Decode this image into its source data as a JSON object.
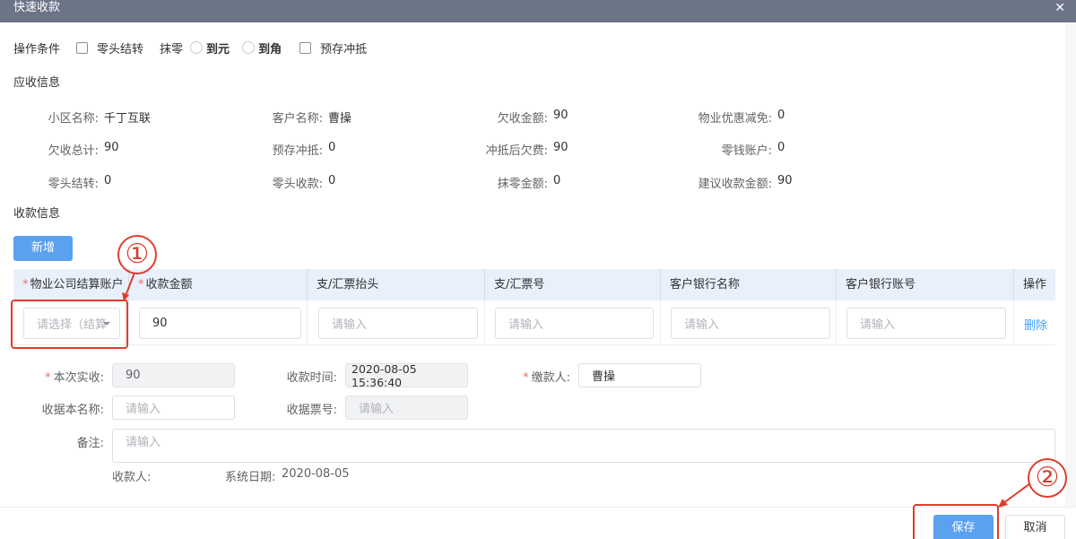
{
  "dialog": {
    "title": "快速收款",
    "close_icon": "close-icon"
  },
  "conditions": {
    "label": "操作条件",
    "zero_settle": "零头结转",
    "round_label": "抹零",
    "round_yuan": "到元",
    "round_jiao": "到角",
    "prepay_offset": "预存冲抵"
  },
  "receivable": {
    "title": "应收信息",
    "fields": [
      {
        "label": "小区名称:",
        "value": "千丁互联"
      },
      {
        "label": "客户名称:",
        "value": "曹操"
      },
      {
        "label": "欠收金额:",
        "value": "90"
      },
      {
        "label": "物业优惠减免:",
        "value": "0"
      },
      {
        "label": "欠收总计:",
        "value": "90"
      },
      {
        "label": "预存冲抵:",
        "value": "0"
      },
      {
        "label": "冲抵后欠费:",
        "value": "90"
      },
      {
        "label": "零钱账户:",
        "value": "0"
      },
      {
        "label": "零头结转:",
        "value": "0"
      },
      {
        "label": "零头收款:",
        "value": "0"
      },
      {
        "label": "抹零金额:",
        "value": "0"
      },
      {
        "label": "建议收款金额:",
        "value": "90"
      }
    ]
  },
  "payment": {
    "title": "收款信息",
    "add_button": "新增",
    "columns": [
      "物业公司结算账户",
      "收款金额",
      "支/汇票抬头",
      "支/汇票号",
      "客户银行名称",
      "客户银行账号",
      "操作"
    ],
    "row": {
      "account_placeholder": "请选择（结算",
      "amount": "90",
      "draft_title_placeholder": "请输入",
      "draft_no_placeholder": "请输入",
      "bank_name_placeholder": "请输入",
      "bank_account_placeholder": "请输入",
      "delete": "删除"
    }
  },
  "form": {
    "actual_label": "本次实收:",
    "actual_value": "90",
    "time_label": "收款时间:",
    "time_value": "2020-08-05 15:36:40",
    "payer_label": "缴款人:",
    "payer_value": "曹操",
    "receipt_label": "收据本名称:",
    "receipt_placeholder": "请输入",
    "receipt_no_label": "收据票号:",
    "receipt_no_placeholder": "请输入",
    "remark_label": "备注:",
    "remark_placeholder": "请输入",
    "collector_label": "收款人:",
    "sysdate_label": "系统日期:",
    "sysdate_value": "2020-08-05"
  },
  "footer": {
    "save": "保存",
    "cancel": "取消"
  },
  "annotations": {
    "step1": "①",
    "step2": "②"
  },
  "colors": {
    "primary": "#5aa1f0",
    "annotation": "#e03c2d",
    "titlebar": "#6c7487",
    "table_header": "#e8f0fb"
  }
}
